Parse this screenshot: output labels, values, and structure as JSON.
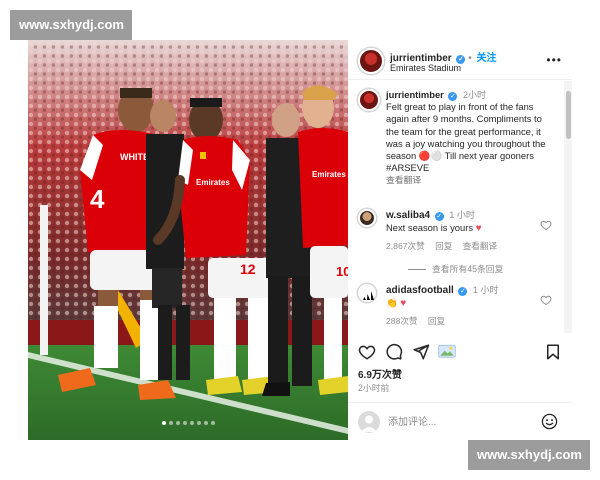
{
  "watermark": {
    "top": "www.sxhydj.com",
    "bottom": "www.sxhydj.com"
  },
  "photo": {
    "carousel": {
      "count": 8,
      "active": 0
    },
    "shirts": {
      "player_left_name": "WHITE",
      "player_left_number": "4",
      "sponsor": "Emirates",
      "player_right_number": "12",
      "player_far_right_number": "10"
    }
  },
  "header": {
    "username": "jurrientimber",
    "follow": "关注",
    "location": "Emirates Stadium"
  },
  "caption": {
    "username": "jurrientimber",
    "time": "2小时",
    "text": "Felt great to play in front of the fans again after 9 months. Compliments to the team for the great performance, it was a joy watching you throughout the season 🔴⚪ Till next year gooners #ARSEVE",
    "translate": "查看翻译"
  },
  "comments": [
    {
      "username": "w.saliba4",
      "time": "1 小时",
      "text": "Next season is yours",
      "likes": "2,867次赞",
      "reply": "回复",
      "translate": "查看翻译"
    },
    {
      "username": "adidasfootball",
      "time": "1 小时",
      "text": "👏",
      "likes": "288次赞",
      "reply": "回复"
    }
  ],
  "view_replies": "查看所有45条回复",
  "like_count": "6.9万次赞",
  "post_time": "2小时前",
  "add_comment_placeholder": "添加评论...",
  "colors": {
    "arsenal_red": "#db0007",
    "link_blue": "#0095f6",
    "heart": "#ed4956"
  }
}
